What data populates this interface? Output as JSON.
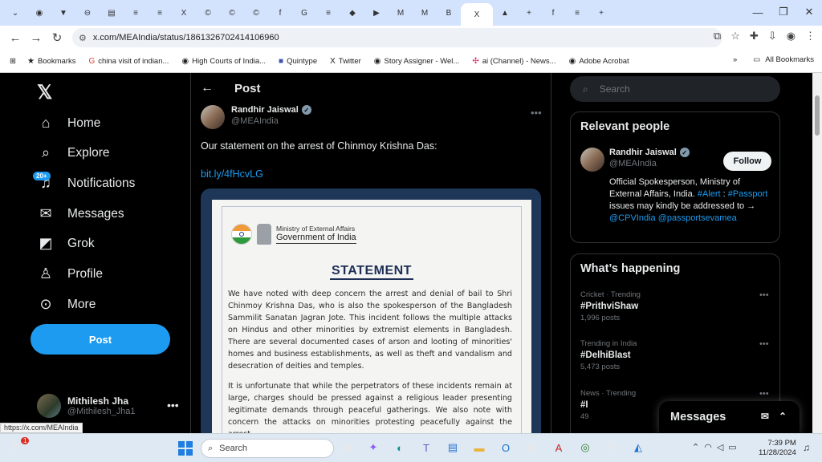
{
  "browser": {
    "tabs": [
      "⌄",
      "◉",
      "▼",
      "⊖",
      "▤",
      "≡",
      "≡",
      "X",
      "©",
      "©",
      "©",
      "f",
      "G",
      "≡",
      "◆",
      "▶",
      "M",
      "M",
      "B",
      "X",
      "▲",
      "+",
      "f",
      "≡"
    ],
    "new_tab": "+",
    "window_controls": [
      "—",
      "❐",
      "✕"
    ],
    "url": "x.com/MEAIndia/status/1861326702414106960",
    "bookmarks": [
      {
        "icon": "★",
        "label": "Bookmarks"
      },
      {
        "icon": "G",
        "label": "china visit of indian..."
      },
      {
        "icon": "◉",
        "label": "High Courts of India..."
      },
      {
        "icon": "■",
        "label": "Quintype"
      },
      {
        "icon": "X",
        "label": "Twitter"
      },
      {
        "icon": "◉",
        "label": "Story Assigner - Wel..."
      },
      {
        "icon": "✣",
        "label": "ai (Channel) - News..."
      },
      {
        "icon": "◉",
        "label": "Adobe Acrobat"
      }
    ],
    "bookmarks_more": "»",
    "all_bookmarks": "All Bookmarks",
    "status_url": "https://x.com/MEAIndia"
  },
  "nav": {
    "items": [
      {
        "icon": "⌂",
        "label": "Home"
      },
      {
        "icon": "⌕",
        "label": "Explore"
      },
      {
        "icon": "♫",
        "label": "Notifications"
      },
      {
        "icon": "✉",
        "label": "Messages"
      },
      {
        "icon": "◩",
        "label": "Grok"
      },
      {
        "icon": "♙",
        "label": "Profile"
      },
      {
        "icon": "⊙",
        "label": "More"
      }
    ],
    "notif_badge": "20+",
    "post_button": "Post",
    "account": {
      "name": "Mithilesh Jha",
      "handle": "@Mithilesh_Jha1",
      "more": "•••"
    }
  },
  "post": {
    "back": "←",
    "header": "Post",
    "author": {
      "name": "Randhir Jaiswal",
      "handle": "@MEAIndia",
      "verified": "✓"
    },
    "more": "•••",
    "text": "Our statement on the arrest of Chinmoy Krishna Das:",
    "link": "bit.ly/4fHcvLG",
    "document": {
      "ministry": "Ministry of External Affairs",
      "govt": "Government of India",
      "heading": "STATEMENT",
      "para1": "We have noted with deep concern the arrest and denial of bail to Shri Chinmoy Krishna Das, who is also the spokesperson of the Bangladesh Sammilit Sanatan Jagran Jote. This incident follows the multiple attacks on Hindus and other minorities by extremist elements in Bangladesh. There are several documented cases of arson and looting of minorities' homes and business establishments, as well as theft and vandalism and desecration of deities and temples.",
      "para2": "It is unfortunate that while the perpetrators of these incidents remain at large, charges should be pressed against a religious leader presenting legitimate demands through peaceful gatherings. We also note with concern the attacks on minorities protesting peacefully against the arrest"
    }
  },
  "right": {
    "search_placeholder": "Search",
    "relevant": {
      "title": "Relevant people",
      "name": "Randhir Jaiswal",
      "handle": "@MEAIndia",
      "follow": "Follow",
      "bio_text1": "Official Spokesperson, Ministry of External Affairs, India. ",
      "bio_tag1": "#Alert",
      "bio_text2": " : ",
      "bio_tag2": "#Passport",
      "bio_text3": " issues may kindly be addressed to → ",
      "bio_tag3": "@CPVIndia",
      "bio_tag4": "@passportsevamea"
    },
    "happening": {
      "title": "What’s happening",
      "trends": [
        {
          "context": "Cricket · Trending",
          "title": "#PrithviShaw",
          "count": "1,996 posts"
        },
        {
          "context": "Trending in India",
          "title": "#DelhiBlast",
          "count": "5,473 posts"
        },
        {
          "context": "News · Trending",
          "title": "#I",
          "count": "49"
        }
      ]
    },
    "messages": "Messages"
  },
  "taskbar": {
    "search": "Search",
    "time": "7:39 PM",
    "date": "11/28/2024",
    "weather_badge": "1"
  },
  "colors": {
    "accent": "#1d9bf0",
    "bg": "#000000",
    "muted": "#71767b"
  }
}
